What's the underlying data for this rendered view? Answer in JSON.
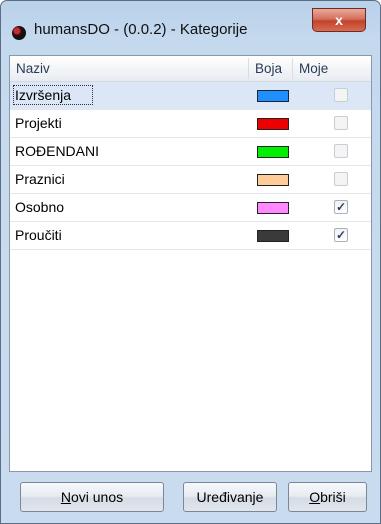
{
  "window": {
    "title": "humansDO - (0.0.2) - Kategorije",
    "close_label": "x"
  },
  "table": {
    "columns": [
      "Naziv",
      "Boja",
      "Moje"
    ],
    "rows": [
      {
        "name": "Izvršenja",
        "color": "#1e90ff",
        "mine": false,
        "mine_mark": "",
        "selected": true
      },
      {
        "name": "Projekti",
        "color": "#ee0000",
        "mine": false,
        "mine_mark": "",
        "selected": false
      },
      {
        "name": "ROĐENDANI",
        "color": "#00ee00",
        "mine": false,
        "mine_mark": "",
        "selected": false
      },
      {
        "name": "Praznici",
        "color": "#ffcc99",
        "mine": false,
        "mine_mark": "",
        "selected": false
      },
      {
        "name": "Osobno",
        "color": "#ff88ff",
        "mine": true,
        "mine_mark": "✓",
        "selected": false
      },
      {
        "name": "Proučiti",
        "color": "#3a3a3a",
        "mine": true,
        "mine_mark": "✓",
        "selected": false
      }
    ]
  },
  "buttons": {
    "new_first": "N",
    "new_rest": "ovi unos",
    "edit": "Uređivanje",
    "delete_first": "O",
    "delete_rest": "briši"
  }
}
